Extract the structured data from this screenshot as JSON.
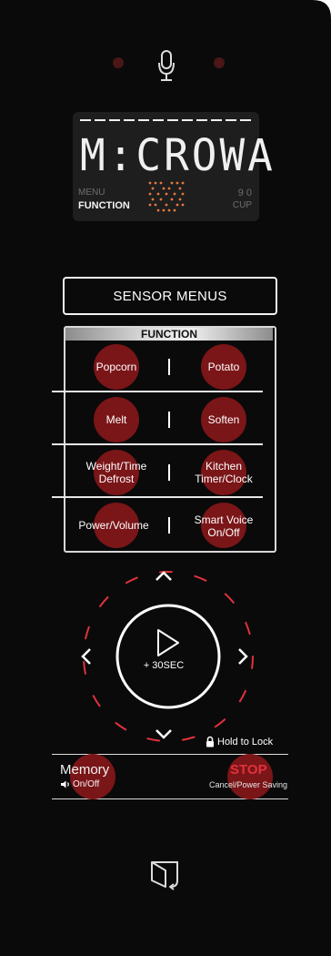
{
  "mic_icon": "microphone-icon",
  "display": {
    "segments": "M:CROWA",
    "left_top": "MENU",
    "left_bottom": "FUNCTION",
    "right_top": "9 0",
    "right_bottom": "CUP"
  },
  "sensor_menus": "SENSOR MENUS",
  "function_header": "FUNCTION",
  "buttons": {
    "popcorn": "Popcorn",
    "potato": "Potato",
    "melt": "Melt",
    "soften": "Soften",
    "weight_time_defrost": [
      "Weight/Time",
      "Defrost"
    ],
    "kitchen_timer_clock": [
      "Kitchen",
      "Timer/Clock"
    ],
    "power_volume": "Power/Volume",
    "smart_voice": [
      "Smart Voice",
      "On/Off"
    ]
  },
  "separator": "|",
  "dial": {
    "start_icon": "play-icon",
    "center_label": "+ 30SEC",
    "up_icon": "chevron-up-icon",
    "down_icon": "chevron-down-icon",
    "left_icon": "chevron-left-icon",
    "right_icon": "chevron-right-icon"
  },
  "lock": {
    "icon": "lock-icon",
    "label": "Hold to Lock"
  },
  "memory": {
    "title": "Memory",
    "sub": "On/Off",
    "icon": "speaker-icon"
  },
  "stop": {
    "title": "STOP",
    "sub": "Cancel/Power Saving"
  },
  "door_icon": "door-open-icon",
  "colors": {
    "panel": "#0a0a0a",
    "accent_red": "#e0323c",
    "button_red": "#7a1518",
    "lcd_orange": "#e8783a"
  }
}
